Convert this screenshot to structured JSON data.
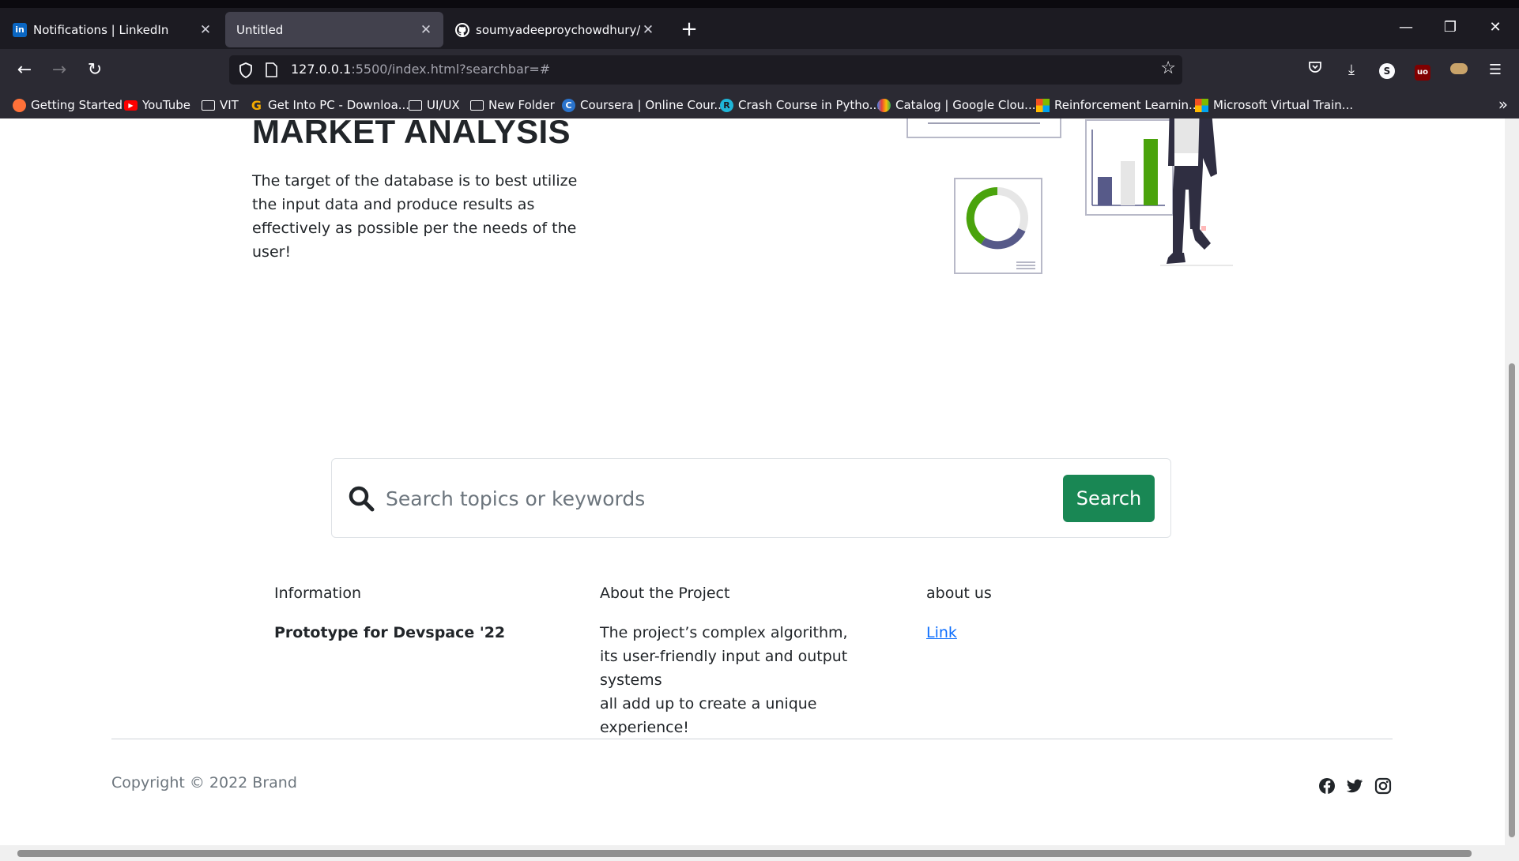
{
  "browser": {
    "tabs": [
      {
        "label": "Notifications | LinkedIn",
        "favicon": "linkedin-icon",
        "active": false
      },
      {
        "label": "Untitled",
        "favicon": "",
        "active": true
      },
      {
        "label": "soumyadeeproychowdhury/Item",
        "favicon": "github-icon",
        "active": false
      }
    ],
    "url_host": "127.0.0.1",
    "url_rest": ":5500/index.html?searchbar=#",
    "bookmarks": [
      {
        "label": "Getting Started",
        "icon": "firefox-icon"
      },
      {
        "label": "YouTube",
        "icon": "youtube-icon"
      },
      {
        "label": "VIT",
        "icon": "folder-icon"
      },
      {
        "label": "Get Into PC - Downloa...",
        "icon": "getintopc-icon"
      },
      {
        "label": "UI/UX",
        "icon": "folder-icon"
      },
      {
        "label": "New Folder",
        "icon": "folder-icon"
      },
      {
        "label": "Coursera | Online Cour...",
        "icon": "coursera-icon"
      },
      {
        "label": "Crash Course in Pytho...",
        "icon": "course-icon"
      },
      {
        "label": "Catalog | Google Clou...",
        "icon": "google-cloud-icon"
      },
      {
        "label": "Reinforcement Learnin...",
        "icon": "microsoft-icon"
      },
      {
        "label": "Microsoft Virtual Train...",
        "icon": "microsoft-icon"
      }
    ]
  },
  "hero": {
    "heading": "MARKET ANALYSIS",
    "text": "The target of the database is to best utilize the input data and produce results as effectively as possible per the needs of the user!"
  },
  "search": {
    "placeholder": "Search topics or keywords",
    "button": "Search"
  },
  "footer": {
    "col1": {
      "heading": "Information",
      "body": "Prototype for Devspace '22"
    },
    "col2": {
      "heading": "About the Project",
      "lines": [
        "The project’s complex algorithm,",
        "its user-friendly input and output systems",
        "all add up to create a unique",
        "experience!"
      ]
    },
    "col3": {
      "heading": "about us",
      "link": "Link"
    },
    "copyright": "Copyright © 2022 Brand",
    "social": [
      "facebook-icon",
      "twitter-icon",
      "instagram-icon"
    ]
  },
  "colors": {
    "primary_button": "#198754",
    "link": "#0d6efd",
    "chart_green": "#4aa30c",
    "chart_purple": "#575a89"
  }
}
